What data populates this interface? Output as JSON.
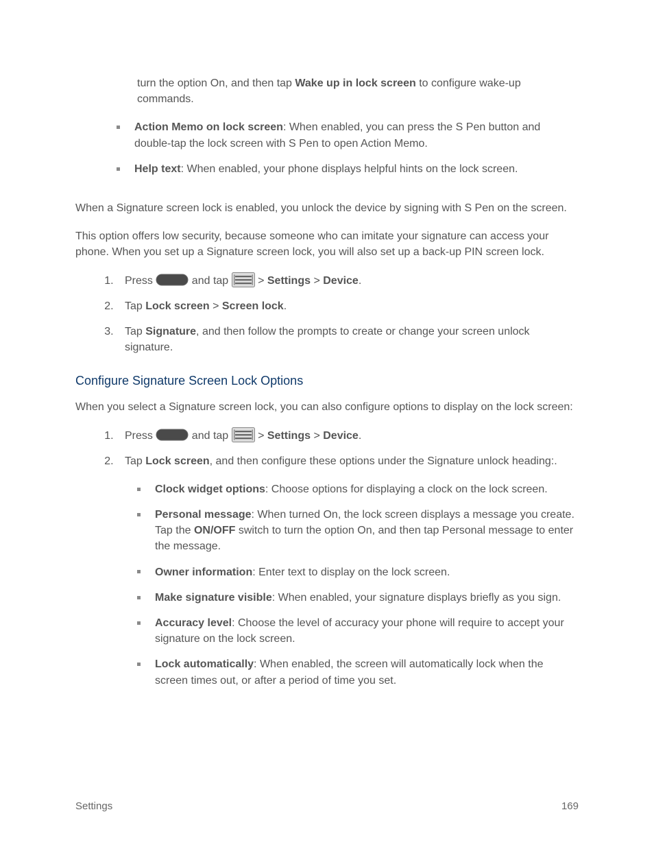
{
  "intro": {
    "continuation": {
      "pre": "turn the option On, and then tap ",
      "bold": "Wake up in lock screen",
      "post": " to configure wake-up commands."
    },
    "bullets": [
      {
        "bold": "Action Memo on lock screen",
        "rest": ": When enabled, you can press the S Pen button and double-tap the lock screen with S Pen to open Action Memo."
      },
      {
        "bold": "Help text",
        "rest": ": When enabled, your phone displays helpful hints on the lock screen."
      }
    ]
  },
  "signature": {
    "p1": "When a Signature screen lock is enabled, you unlock the device by signing with S Pen on the screen.",
    "p2": "This option offers low security, because someone who can imitate your signature can access your phone. When you set up a Signature screen lock, you will also set up a back-up PIN screen lock.",
    "steps": [
      {
        "press": "Press ",
        "andtap": " and tap ",
        "gt1": " > ",
        "settings": "Settings",
        "gt2": " > ",
        "device": "Device",
        "end": "."
      },
      {
        "pre": "Tap ",
        "b1": "Lock screen",
        "mid": " > ",
        "b2": "Screen lock",
        "post": "."
      },
      {
        "pre": "Tap ",
        "b1": "Signature",
        "post": ", and then follow the prompts to create or change your screen unlock signature."
      }
    ]
  },
  "configure": {
    "heading": "Configure Signature Screen Lock Options",
    "intro": "When you select a Signature screen lock, you can also configure options to display on the lock screen:",
    "steps": [
      {
        "press": "Press ",
        "andtap": " and tap ",
        "gt1": " > ",
        "settings": "Settings",
        "gt2": " > ",
        "device": "Device",
        "end": "."
      },
      {
        "pre": "Tap ",
        "b1": "Lock screen",
        "post": ", and then configure these options under the Signature unlock heading:."
      }
    ],
    "bullets": [
      {
        "bold": "Clock widget options",
        "rest": ": Choose options for displaying a clock on the lock screen."
      },
      {
        "bold": "Personal message",
        "pre": ": When turned On, the lock screen displays a message you create. Tap the ",
        "bold2": "ON/OFF",
        "post": " switch to turn the option On, and then tap Personal message to enter the message."
      },
      {
        "bold": "Owner information",
        "rest": ": Enter text to display on the lock screen."
      },
      {
        "bold": "Make signature visible",
        "rest": ": When enabled, your signature displays briefly as you sign."
      },
      {
        "bold": "Accuracy level",
        "rest": ": Choose the level of accuracy your phone will require to accept your signature on the lock screen."
      },
      {
        "bold": "Lock automatically",
        "rest": ": When enabled, the screen will automatically lock when the screen times out, or after a period of time you set."
      }
    ]
  },
  "footer": {
    "left": "Settings",
    "right": "169"
  }
}
